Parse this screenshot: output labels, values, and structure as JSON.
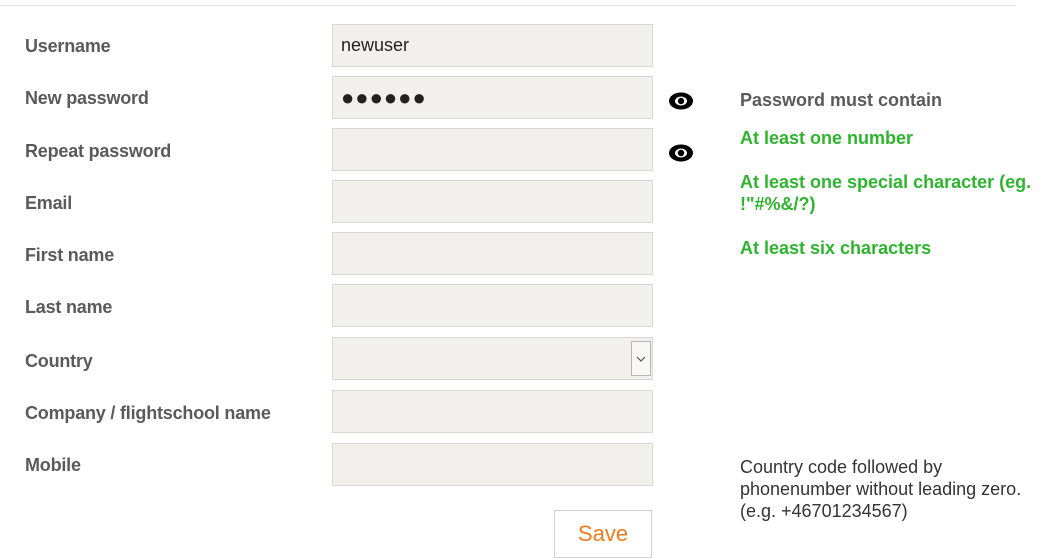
{
  "form": {
    "username": {
      "label": "Username",
      "value": "newuser"
    },
    "new_password": {
      "label": "New password",
      "value": "●●●●●●"
    },
    "repeat_password": {
      "label": "Repeat password",
      "value": ""
    },
    "email": {
      "label": "Email",
      "value": ""
    },
    "first_name": {
      "label": "First name",
      "value": ""
    },
    "last_name": {
      "label": "Last name",
      "value": ""
    },
    "country": {
      "label": "Country",
      "value": ""
    },
    "company": {
      "label": "Company / flightschool name",
      "value": ""
    },
    "mobile": {
      "label": "Mobile",
      "value": ""
    },
    "save_label": "Save"
  },
  "password_rules": {
    "title": "Password must contain",
    "items": [
      "At least one number",
      "At least one special character (eg. !\"#%&/?)",
      "At least six characters"
    ],
    "color": "#2eb52e"
  },
  "mobile_hint": "Country code followed by phonenumber without leading zero. (e.g. +46701234567)",
  "icons": {
    "show_password": "eye-icon",
    "dropdown": "chevron-down-icon"
  },
  "colors": {
    "save_text": "#f07a1e",
    "field_background": "#f1f0ec"
  }
}
